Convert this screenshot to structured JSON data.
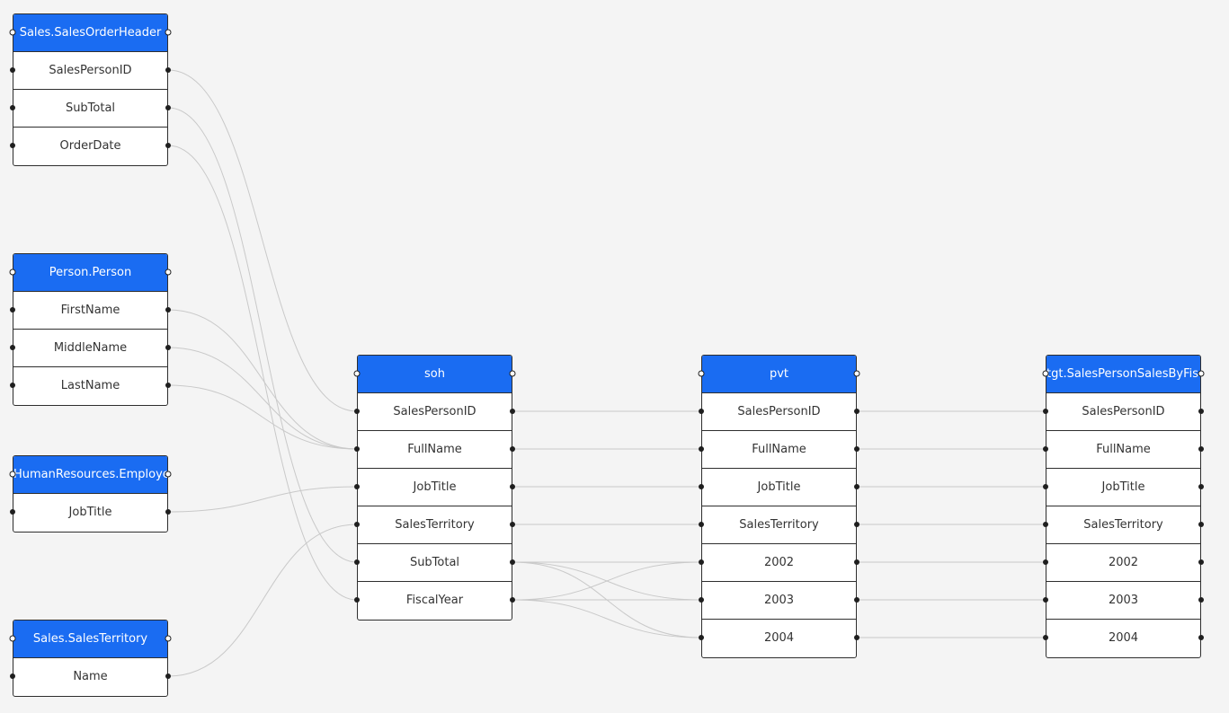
{
  "nodes": [
    {
      "id": "soh_src",
      "title": "Sales.SalesOrderHeader",
      "columns": [
        "SalesPersonID",
        "SubTotal",
        "OrderDate"
      ]
    },
    {
      "id": "person",
      "title": "Person.Person",
      "columns": [
        "FirstName",
        "MiddleName",
        "LastName"
      ]
    },
    {
      "id": "employee",
      "title": "HumanResources.Employee",
      "columns": [
        "JobTitle"
      ]
    },
    {
      "id": "territory",
      "title": "Sales.SalesTerritory",
      "columns": [
        "Name"
      ]
    },
    {
      "id": "soh",
      "title": "soh",
      "columns": [
        "SalesPersonID",
        "FullName",
        "JobTitle",
        "SalesTerritory",
        "SubTotal",
        "FiscalYear"
      ]
    },
    {
      "id": "pvt",
      "title": "pvt",
      "columns": [
        "SalesPersonID",
        "FullName",
        "JobTitle",
        "SalesTerritory",
        "2002",
        "2003",
        "2004"
      ]
    },
    {
      "id": "tgt",
      "title": "tgt.SalesPersonSalesByFiscalYears",
      "columns": [
        "SalesPersonID",
        "FullName",
        "JobTitle",
        "SalesTerritory",
        "2002",
        "2003",
        "2004"
      ]
    }
  ],
  "edges": [
    {
      "from": "soh_src.SalesPersonID",
      "to": "soh.SalesPersonID"
    },
    {
      "from": "soh_src.SubTotal",
      "to": "soh.SubTotal"
    },
    {
      "from": "soh_src.OrderDate",
      "to": "soh.FiscalYear"
    },
    {
      "from": "person.FirstName",
      "to": "soh.FullName"
    },
    {
      "from": "person.MiddleName",
      "to": "soh.FullName"
    },
    {
      "from": "person.LastName",
      "to": "soh.FullName"
    },
    {
      "from": "employee.JobTitle",
      "to": "soh.JobTitle"
    },
    {
      "from": "territory.Name",
      "to": "soh.SalesTerritory"
    },
    {
      "from": "soh.SalesPersonID",
      "to": "pvt.SalesPersonID"
    },
    {
      "from": "soh.FullName",
      "to": "pvt.FullName"
    },
    {
      "from": "soh.JobTitle",
      "to": "pvt.JobTitle"
    },
    {
      "from": "soh.SalesTerritory",
      "to": "pvt.SalesTerritory"
    },
    {
      "from": "soh.SubTotal",
      "to": "pvt.2002"
    },
    {
      "from": "soh.SubTotal",
      "to": "pvt.2003"
    },
    {
      "from": "soh.SubTotal",
      "to": "pvt.2004"
    },
    {
      "from": "soh.FiscalYear",
      "to": "pvt.2002"
    },
    {
      "from": "soh.FiscalYear",
      "to": "pvt.2003"
    },
    {
      "from": "soh.FiscalYear",
      "to": "pvt.2004"
    },
    {
      "from": "pvt.SalesPersonID",
      "to": "tgt.SalesPersonID"
    },
    {
      "from": "pvt.FullName",
      "to": "tgt.FullName"
    },
    {
      "from": "pvt.JobTitle",
      "to": "tgt.JobTitle"
    },
    {
      "from": "pvt.SalesTerritory",
      "to": "tgt.SalesTerritory"
    },
    {
      "from": "pvt.2002",
      "to": "tgt.2002"
    },
    {
      "from": "pvt.2003",
      "to": "tgt.2003"
    },
    {
      "from": "pvt.2004",
      "to": "tgt.2004"
    }
  ],
  "colors": {
    "header": "#1a6cf2",
    "edge": "#c9c9c9",
    "background": "#f4f4f4"
  }
}
